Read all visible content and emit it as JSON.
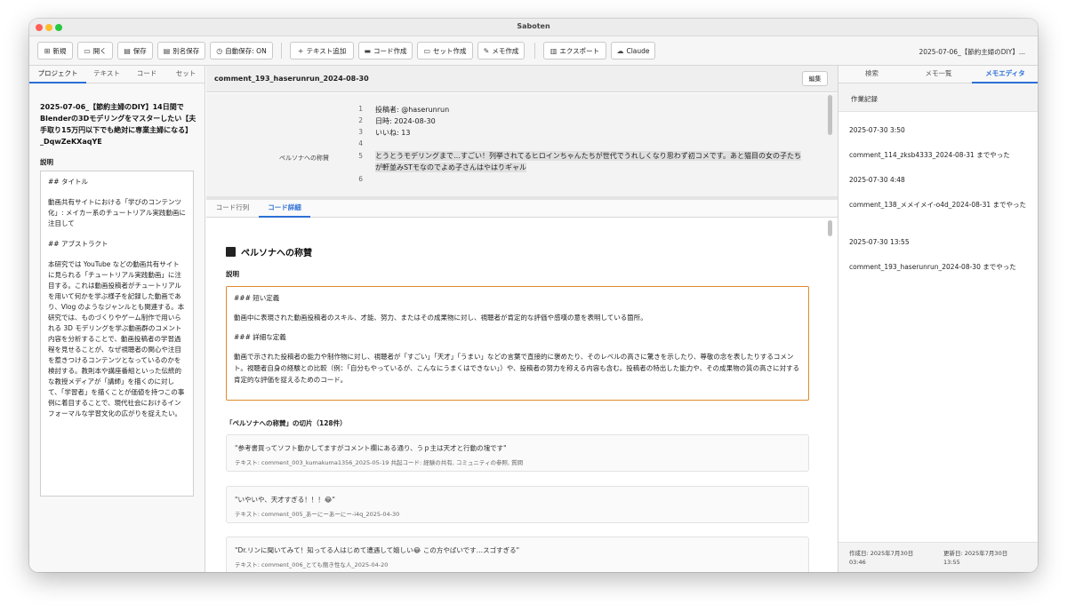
{
  "window": {
    "title": "Saboten"
  },
  "toolbar": {
    "buttons": [
      {
        "icon": "⊞",
        "label": "新規"
      },
      {
        "icon": "▭",
        "label": "開く"
      },
      {
        "icon": "▤",
        "label": "保存"
      },
      {
        "icon": "▤",
        "label": "別名保存"
      },
      {
        "icon": "◷",
        "label": "自動保存: ON"
      },
      {
        "icon": "+",
        "label": "テキスト追加"
      },
      {
        "icon": "▬",
        "label": "コード作成"
      },
      {
        "icon": "▭",
        "label": "セット作成"
      },
      {
        "icon": "✎",
        "label": "メモ作成"
      },
      {
        "icon": "▥",
        "label": "エクスポート"
      },
      {
        "icon": "☁",
        "label": "Claude"
      }
    ],
    "right_text": "2025-07-06_【節約主婦のDIY】..."
  },
  "left_panel": {
    "tabs": [
      "プロジェクト",
      "テキスト",
      "コード",
      "セット"
    ],
    "doc_title": "2025-07-06_【節約主婦のDIY】14日間でBlenderの3Dモデリングをマスターしたい【夫手取り15万円以下でも絶対に専業主婦になる】_DqwZeKXaqYE",
    "desc_label": "説明",
    "description": [
      "## タイトル",
      "動画共有サイトにおける「学びのコンテンツ化」: メイカー系のチュートリアル実践動画に注目して",
      "## アブストラクト",
      "本研究では YouTube などの動画共有サイトに見られる「チュートリアル実践動画」に注目する。これは動画投稿者がチュートリアルを用いて何かを学ぶ様子を記録した動画であり、Vlog のようなジャンルとも関連する。本研究では、ものづくりやゲーム制作で用いられる 3D モデリングを学ぶ動画群のコメント内容を分析することで、動画投稿者の学習過程を見せることが、なぜ視聴者の関心や注目を惹きつけるコンテンツとなっているのかを検討する。教則本や講座番組といった伝統的な教授メディアが「講師」を描くのに対して、「学習者」を描くことが価値を持つこの事例に着目することで、現代社会におけるインフォーマルな学習文化の広がりを捉えたい。"
    ]
  },
  "center": {
    "header_title": "comment_193_haserunrun_2024-08-30",
    "edit_label": "編集",
    "code_lines": [
      {
        "n": "1",
        "text": "投稿者: @haserunrun"
      },
      {
        "n": "2",
        "text": "日時: 2024-08-30"
      },
      {
        "n": "3",
        "text": "いいね: 13"
      },
      {
        "n": "4",
        "text": ""
      },
      {
        "n": "5",
        "text": "とうとうモデリングまで…すごい！列挙されてるヒロインちゃんたちが世代でうれしくなり思わず初コメです。あと猫目の女の子たち"
      },
      {
        "n": "",
        "text": "が軒並みSTモなのでよめ子さんはやはりギャル"
      },
      {
        "n": "6",
        "text": ""
      }
    ],
    "code_label": "ペルソナへの称賛",
    "tabs": [
      "コード行列",
      "コード詳細"
    ],
    "detail": {
      "code_name": "ペルソナへの称賛",
      "desc_label": "説明",
      "definition": [
        "### 短い定義",
        "動画中に表現された動画投稿者のスキル、才能、努力、またはその成果物に対し、視聴者が肯定的な評価や感嘆の意を表明している箇所。",
        "### 詳細な定義",
        "動画で示された投稿者の能力や制作物に対し、視聴者が「すごい」「天才」「うまい」などの言葉で直接的に褒めたり、そのレベルの高さに驚きを示したり、尊敬の念を表したりするコメント。視聴者自身の経験との比較（例：「自分もやっているが、こんなにうまくはできない」）や、投稿者の努力を称える内容も含む。投稿者の特出した能力や、その成果物の質の高さに対する肯定的な評価を捉えるためのコード。"
      ],
      "slices_title": "「ペルソナへの称賛」の切片（128件）",
      "slices": [
        {
          "quote": "\"参考書買ってソフト動かしてますがコメント欄にある通り、うｐ主は天才と行動の塊です\"",
          "meta": "テキスト: comment_003_kumakuma1356_2025-05-19   共起コード: 経験の共有, コミュニティの参照, 質問"
        },
        {
          "quote": "\"いやいや、天才すぎる！！！😂\"",
          "meta": "テキスト: comment_005_あーにーあーにー-i4q_2025-04-30"
        },
        {
          "quote": "\"Dr.リンに聞いてみて！知ってる人はじめて遭遇して嬉しい😂 この方やばいです…スゴすぎる\"",
          "meta": "テキスト: comment_006_とても飽き性な人_2025-04-20"
        }
      ]
    }
  },
  "right_panel": {
    "tabs": [
      "検索",
      "メモ一覧",
      "メモエディタ"
    ],
    "memo_title": "作業記録",
    "memo_lines": [
      "2025-07-30 3:50",
      "comment_114_zksb4333_2024-08-31 までやった",
      "2025-07-30 4:48",
      "comment_138_メメイメイ-o4d_2024-08-31 までやった",
      "2025-07-30 13:55",
      "comment_193_haserunrun_2024-08-30 までやった"
    ],
    "created": "作成日: 2025年7月30日 03:46",
    "updated": "更新日: 2025年7月30日 13:55"
  }
}
